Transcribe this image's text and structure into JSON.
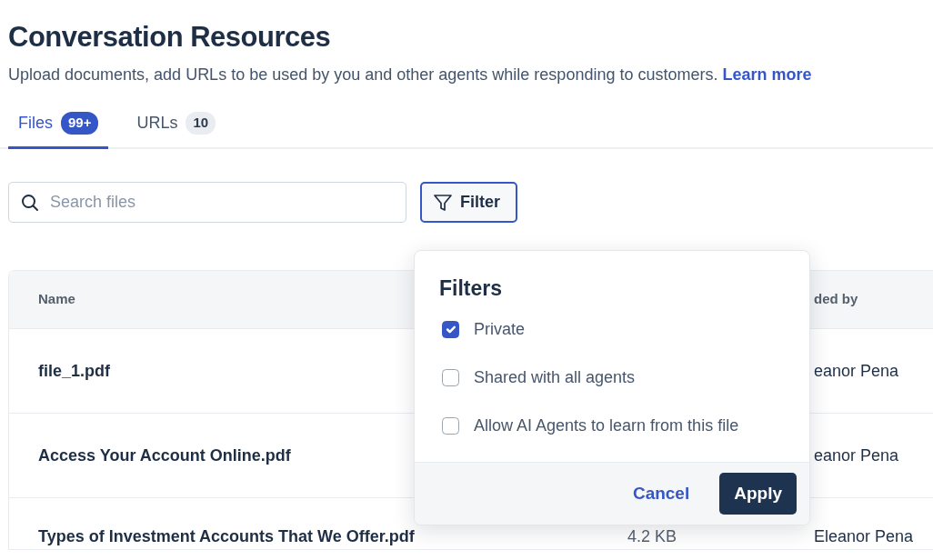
{
  "page": {
    "title": "Conversation Resources",
    "description": "Upload documents, add URLs to be used by you and other agents while responding to customers.",
    "link": "Learn more"
  },
  "tabs": [
    {
      "label": "Files",
      "count": "99+",
      "selected": true
    },
    {
      "label": "URLs",
      "count": "10",
      "selected": false
    }
  ],
  "search": {
    "placeholder": "Search files"
  },
  "filter_button": {
    "label": "Filter",
    "active": true
  },
  "table": {
    "columns": [
      "Name",
      "ded by"
    ],
    "rows": [
      {
        "name": "file_1.pdf",
        "uploaded_by": "eanor Pena"
      },
      {
        "name": "Access Your Account Online.pdf",
        "uploaded_by": "eanor Pena"
      },
      {
        "name": "Types of Investment Accounts That We Offer.pdf",
        "size": "4.2 KB",
        "uploaded_by": "Eleanor Pena"
      }
    ]
  },
  "filters_popup": {
    "title": "Filters",
    "options": [
      {
        "label": "Private",
        "checked": true
      },
      {
        "label": "Shared with all agents",
        "checked": false
      },
      {
        "label": "Allow AI Agents to learn from this file",
        "checked": false
      }
    ],
    "buttons": [
      {
        "label": "Cancel",
        "kind": "link"
      },
      {
        "label": "Apply",
        "kind": "primary"
      }
    ]
  }
}
